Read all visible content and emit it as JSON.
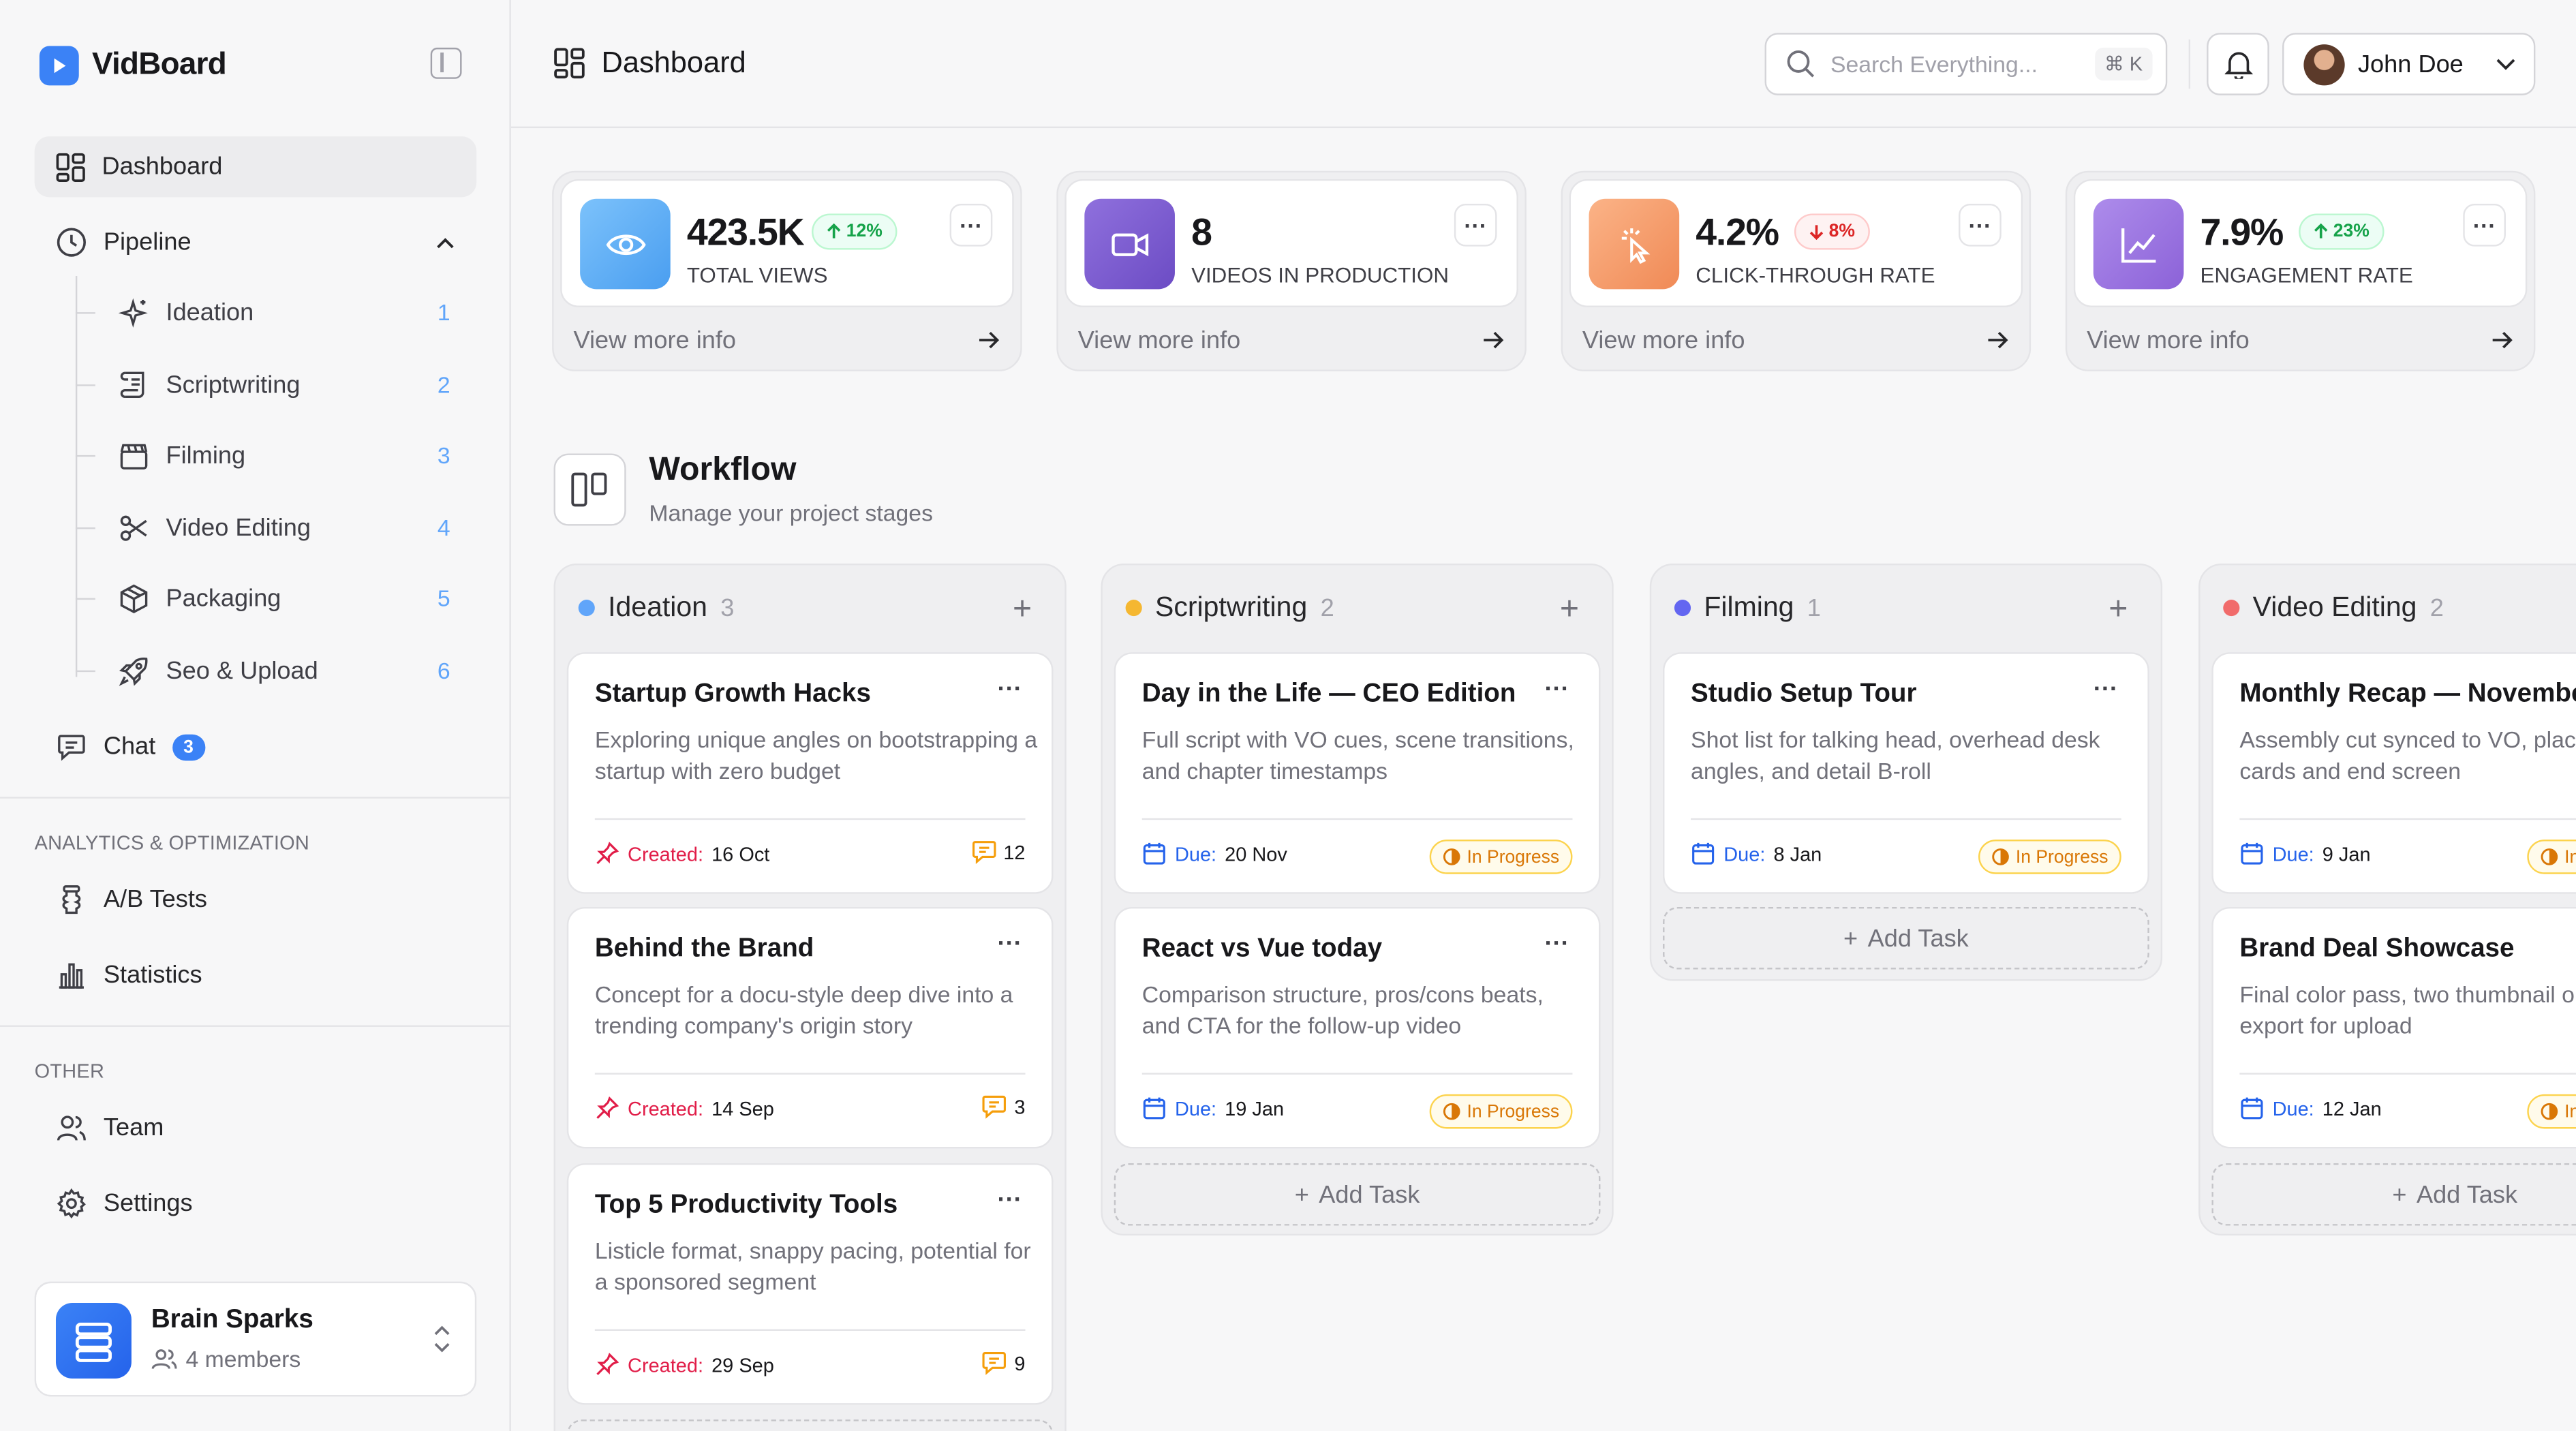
{
  "app": {
    "name": "VidBoard"
  },
  "nav": {
    "dashboard": "Dashboard",
    "pipeline": "Pipeline",
    "pipeline_items": [
      {
        "label": "Ideation",
        "count": "1",
        "icon": "sparkle-icon"
      },
      {
        "label": "Scriptwriting",
        "count": "2",
        "icon": "scroll-icon"
      },
      {
        "label": "Filming",
        "count": "3",
        "icon": "clapperboard-icon"
      },
      {
        "label": "Video Editing",
        "count": "4",
        "icon": "scissors-icon"
      },
      {
        "label": "Packaging",
        "count": "5",
        "icon": "package-icon"
      },
      {
        "label": "Seo & Upload",
        "count": "6",
        "icon": "rocket-icon"
      }
    ],
    "chat": "Chat",
    "chat_badge": "3",
    "section_analytics": "ANALYTICS & OPTIMIZATION",
    "ab_tests": "A/B Tests",
    "statistics": "Statistics",
    "section_other": "OTHER",
    "team": "Team",
    "settings": "Settings"
  },
  "team_switcher": {
    "name": "Brain Sparks",
    "members": "4 members"
  },
  "topbar": {
    "title": "Dashboard",
    "search_placeholder": "Search Everything...",
    "shortcut": "⌘ K",
    "user_name": "John Doe"
  },
  "stats": [
    {
      "value": "423.5K",
      "label": "TOTAL VIEWS",
      "trend": "12%",
      "trend_dir": "up",
      "icon": "eye-icon",
      "color": "#5aa9f5",
      "link": "View more info"
    },
    {
      "value": "8",
      "label": "VIDEOS IN PRODUCTION",
      "trend": "",
      "trend_dir": "",
      "icon": "video-camera-icon",
      "color": "#7c5ccf",
      "link": "View more info"
    },
    {
      "value": "4.2%",
      "label": "CLICK-THROUGH RATE",
      "trend": "8%",
      "trend_dir": "down",
      "icon": "cursor-click-icon",
      "color": "#f59b6b",
      "link": "View more info"
    },
    {
      "value": "7.9%",
      "label": "ENGAGEMENT RATE",
      "trend": "23%",
      "trend_dir": "up",
      "icon": "chart-line-icon",
      "color": "#9a73e0",
      "link": "View more info"
    }
  ],
  "workflow": {
    "title": "Workflow",
    "subtitle": "Manage your project stages",
    "add_task": "Add Task"
  },
  "columns": [
    {
      "name": "Ideation",
      "count": "3",
      "color": "#60a5fa",
      "tasks": [
        {
          "title": "Startup Growth Hacks",
          "desc": "Exploring unique angles on bootstrapping a startup with zero budget",
          "meta_label": "Created:",
          "meta_value": "16 Oct",
          "comments": "12"
        },
        {
          "title": "Behind the Brand",
          "desc": "Concept for a docu-style deep dive into a trending company's origin story",
          "meta_label": "Created:",
          "meta_value": "14 Sep",
          "comments": "3"
        },
        {
          "title": "Top 5 Productivity Tools",
          "desc": "Listicle format, snappy pacing, potential for a sponsored segment",
          "meta_label": "Created:",
          "meta_value": "29 Sep",
          "comments": "9"
        }
      ]
    },
    {
      "name": "Scriptwriting",
      "count": "2",
      "color": "#f5b731",
      "tasks": [
        {
          "title": "Day in the Life — CEO Edition",
          "desc": "Full script with VO cues, scene transitions, and chapter timestamps",
          "meta_label": "Due:",
          "meta_value": "20 Nov",
          "status": "In Progress"
        },
        {
          "title": "React vs Vue today",
          "desc": "Comparison structure, pros/cons beats, and CTA for the follow-up video",
          "meta_label": "Due:",
          "meta_value": "19 Jan",
          "status": "In Progress"
        }
      ]
    },
    {
      "name": "Filming",
      "count": "1",
      "color": "#6366f1",
      "tasks": [
        {
          "title": "Studio Setup Tour",
          "desc": "Shot list for talking head, overhead desk angles, and detail B-roll",
          "meta_label": "Due:",
          "meta_value": "8 Jan",
          "status": "In Progress"
        }
      ]
    },
    {
      "name": "Video Editing",
      "count": "2",
      "color": "#f16b6b",
      "tasks": [
        {
          "title": "Monthly Recap — November",
          "desc": "Assembly cut synced to VO, placeholder cards and end screen",
          "meta_label": "Due:",
          "meta_value": "9 Jan",
          "status": "In Progress"
        },
        {
          "title": "Brand Deal Showcase",
          "desc": "Final color pass, two thumbnail options, export for upload",
          "meta_label": "Due:",
          "meta_value": "12 Jan",
          "status": "In Progress"
        }
      ]
    }
  ]
}
